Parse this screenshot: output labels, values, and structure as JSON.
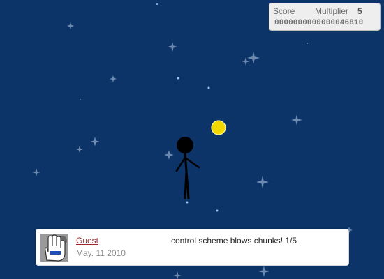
{
  "game": {
    "score_label": "Score",
    "multiplier_label": "Multiplier",
    "multiplier": "5",
    "score": "0000000000000046810"
  },
  "comment": {
    "author": "Guest",
    "date": "May. 11 2010",
    "text": "control scheme blows chunks! 1/5",
    "avatar_icon": "hand-cursor-icon"
  },
  "colors": {
    "sky": "#0c3468",
    "orb": "#f1d800",
    "stick_figure": "#000000",
    "author_link": "#a02828"
  }
}
